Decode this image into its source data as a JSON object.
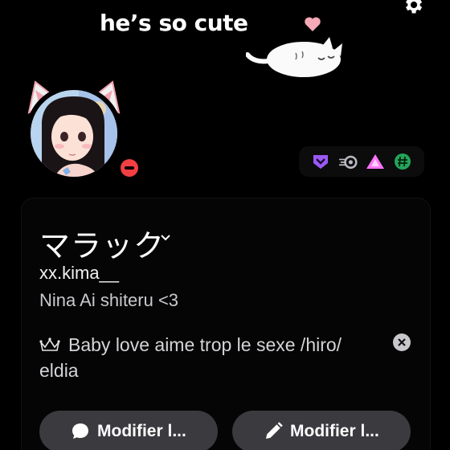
{
  "banner": {
    "text": "he’s so cute",
    "icons": [
      "gear-icon",
      "heart-icon",
      "sleeping-cat-doodle"
    ]
  },
  "avatar": {
    "status": "do-not-disturb",
    "status_color": "#f23f43"
  },
  "badges": [
    {
      "name": "hypesquad-badge",
      "color": "#9b59f5"
    },
    {
      "name": "nitro-badge",
      "color": "#b9b9c2"
    },
    {
      "name": "server-booster-badge",
      "color": "#ff73fa"
    },
    {
      "name": "active-developer-badge",
      "color": "#23a55a"
    }
  ],
  "profile": {
    "display_name": "マラック",
    "username": "xx.kima__",
    "pronouns": "Nina Ai shiteru <3",
    "custom_status": "Baby love aime trop le sexe /hiro/ eldia",
    "custom_status_icon": "crown-icon"
  },
  "actions": {
    "edit_status_label": "Modifier l...",
    "edit_profile_label": "Modifier l..."
  },
  "colors": {
    "background": "#000000",
    "button": "#3a3a3f",
    "dnd": "#f23f43"
  }
}
